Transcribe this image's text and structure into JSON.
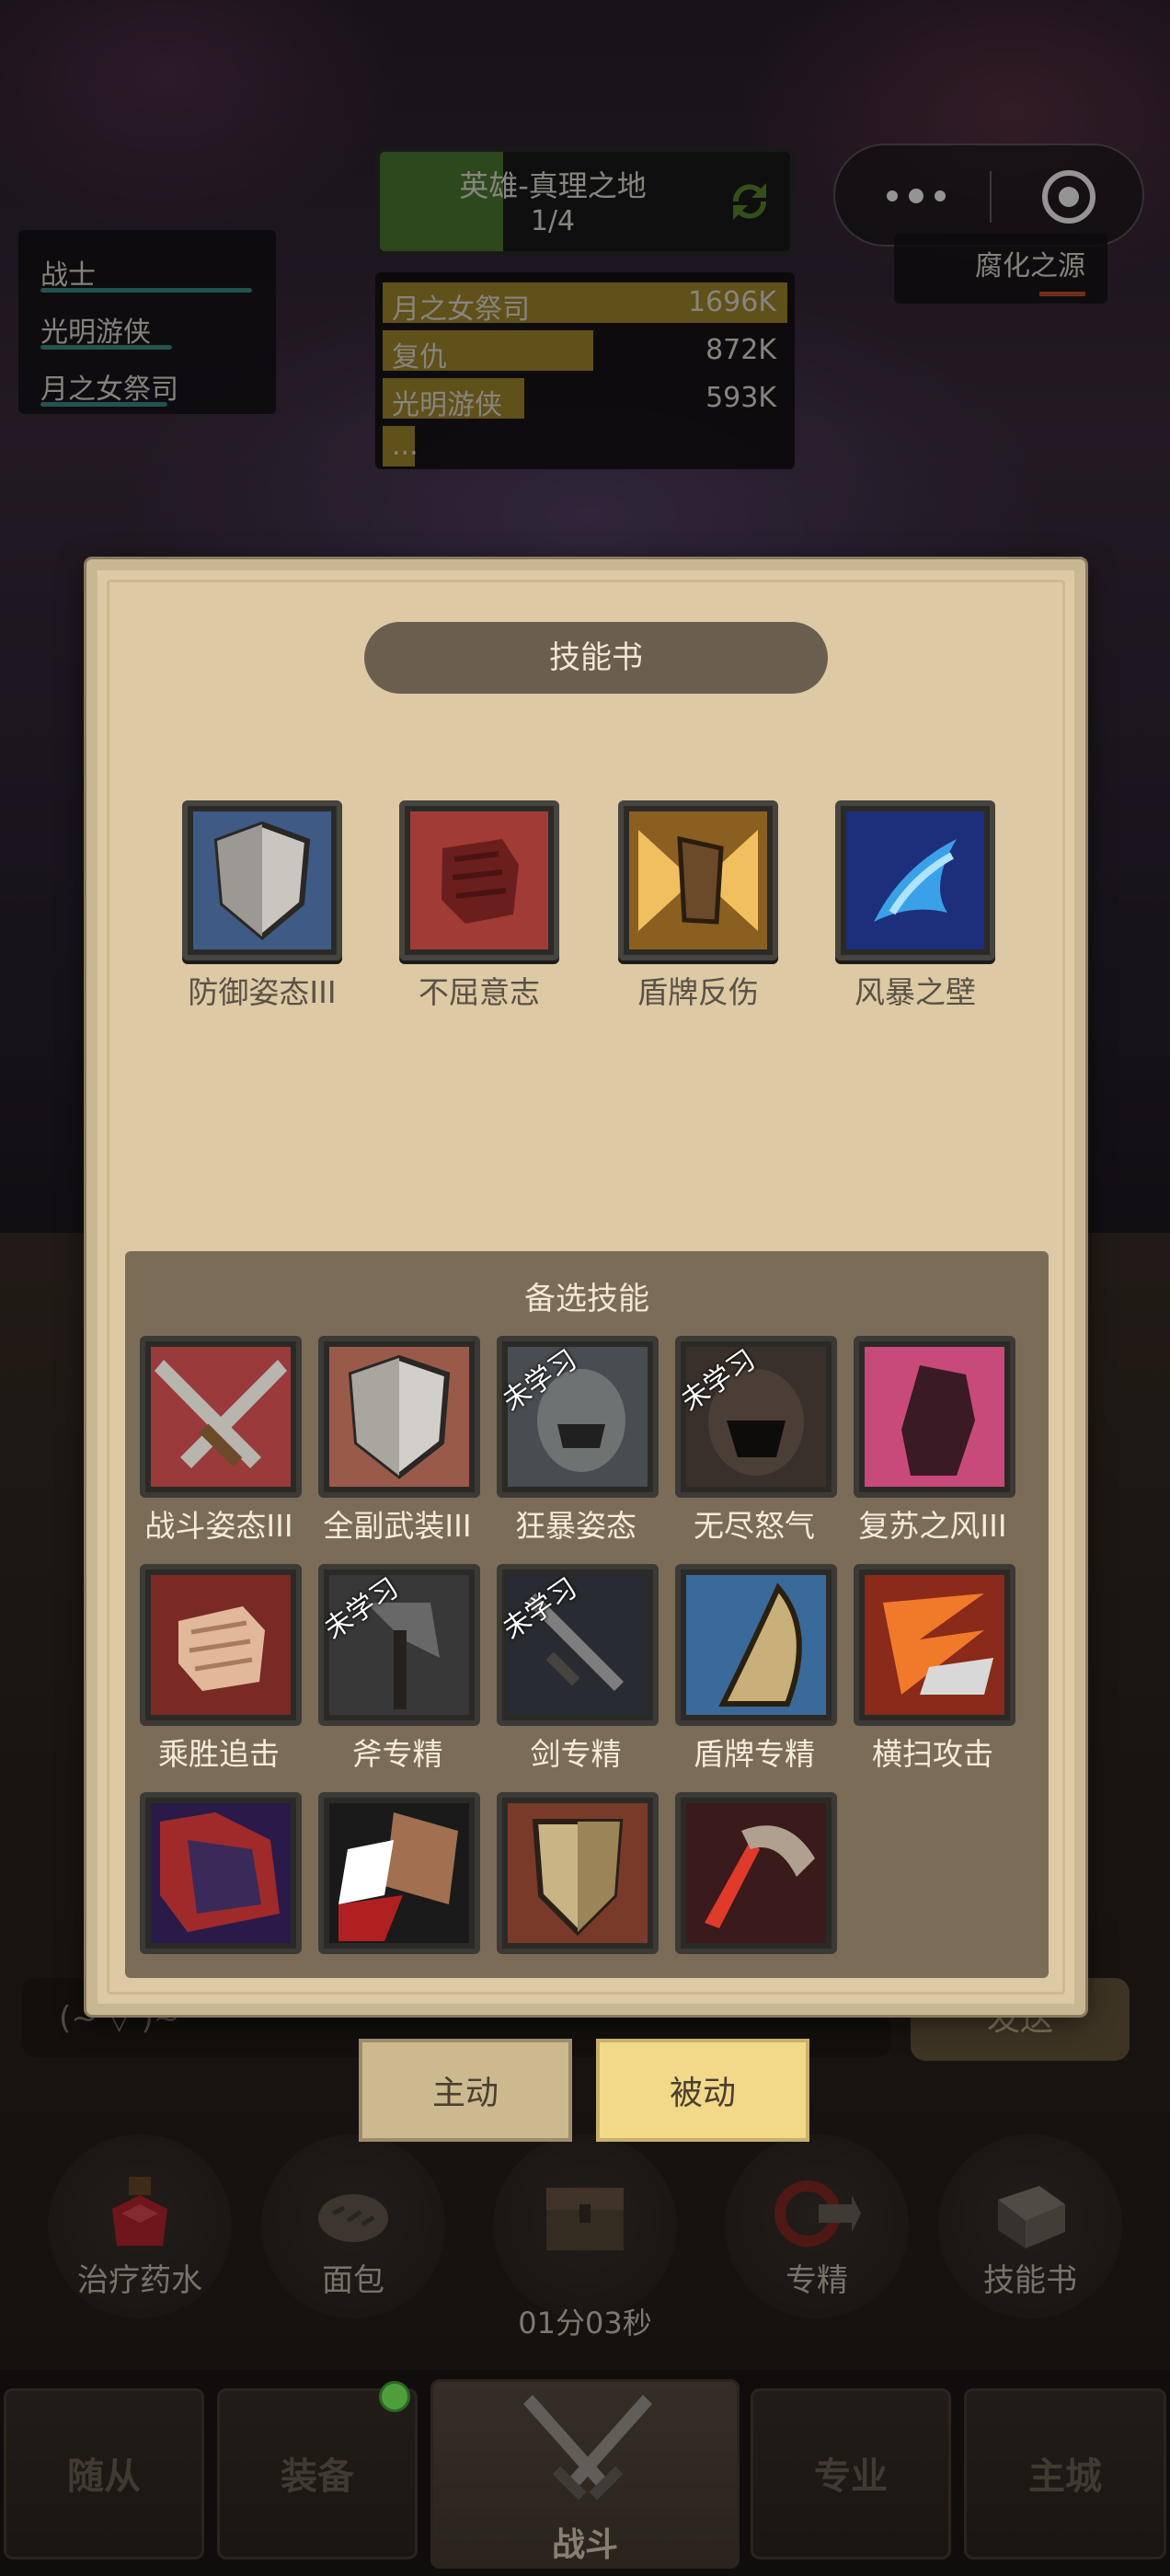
{
  "party": [
    {
      "name": "战士",
      "hp": 1.0
    },
    {
      "name": "光明游侠",
      "hp": 0.62
    },
    {
      "name": "月之女祭司",
      "hp": 0.6
    }
  ],
  "dungeon": {
    "title": "英雄-真理之地",
    "count": "1/4",
    "progress": 0.3
  },
  "dps": [
    {
      "name": "月之女祭司",
      "value": "1696K",
      "fill": 1.0
    },
    {
      "name": "复仇",
      "value": "872K",
      "fill": 0.52
    },
    {
      "name": "光明游侠",
      "value": "593K",
      "fill": 0.35
    },
    {
      "name": "...",
      "value": "",
      "fill": 0.08
    }
  ],
  "boss": {
    "name": "腐化之源"
  },
  "dialog": {
    "title": "技能书",
    "equipped": [
      {
        "label": "防御姿态III",
        "icon": "shield-skill-icon"
      },
      {
        "label": "不屈意志",
        "icon": "fist-skill-icon"
      },
      {
        "label": "盾牌反伤",
        "icon": "shield-reflect-icon"
      },
      {
        "label": "风暴之壁",
        "icon": "storm-wall-icon"
      }
    ],
    "backup_title": "备选技能",
    "backup": [
      {
        "label": "战斗姿态III",
        "icon": "crossed-swords-icon",
        "unlearned": ""
      },
      {
        "label": "全副武装III",
        "icon": "armor-shield-icon",
        "unlearned": ""
      },
      {
        "label": "狂暴姿态",
        "icon": "berserk-icon",
        "unlearned": "未学习"
      },
      {
        "label": "无尽怒气",
        "icon": "rage-icon",
        "unlearned": "未学习"
      },
      {
        "label": "复苏之风III",
        "icon": "revive-wind-icon",
        "unlearned": ""
      },
      {
        "label": "乘胜追击",
        "icon": "punch-icon",
        "unlearned": ""
      },
      {
        "label": "斧专精",
        "icon": "axe-mastery-icon",
        "unlearned": "未学习"
      },
      {
        "label": "剑专精",
        "icon": "sword-mastery-icon",
        "unlearned": "未学习"
      },
      {
        "label": "盾牌专精",
        "icon": "shield-mastery-icon",
        "unlearned": ""
      },
      {
        "label": "横扫攻击",
        "icon": "sweep-attack-icon",
        "unlearned": ""
      },
      {
        "label": "",
        "icon": "dark-giant-icon",
        "unlearned": ""
      },
      {
        "label": "",
        "icon": "blood-beast-icon",
        "unlearned": ""
      },
      {
        "label": "",
        "icon": "shield-crest-icon",
        "unlearned": ""
      },
      {
        "label": "",
        "icon": "claw-strike-icon",
        "unlearned": ""
      }
    ]
  },
  "tabs": {
    "active_skill": "主动",
    "passive_skill": "被动"
  },
  "chat": {
    "placeholder": "(~  ▽  )~",
    "send": "发送"
  },
  "actions": [
    {
      "label": "治疗药水",
      "icon": "potion-icon"
    },
    {
      "label": "面包",
      "icon": "bread-icon"
    },
    {
      "label": "",
      "icon": "chest-icon"
    },
    {
      "label": "专精",
      "icon": "mastery-icon"
    },
    {
      "label": "技能书",
      "icon": "skill-book-icon"
    }
  ],
  "timer": "01分03秒",
  "nav": [
    "随从",
    "装备",
    "战斗",
    "专业",
    "主城"
  ]
}
